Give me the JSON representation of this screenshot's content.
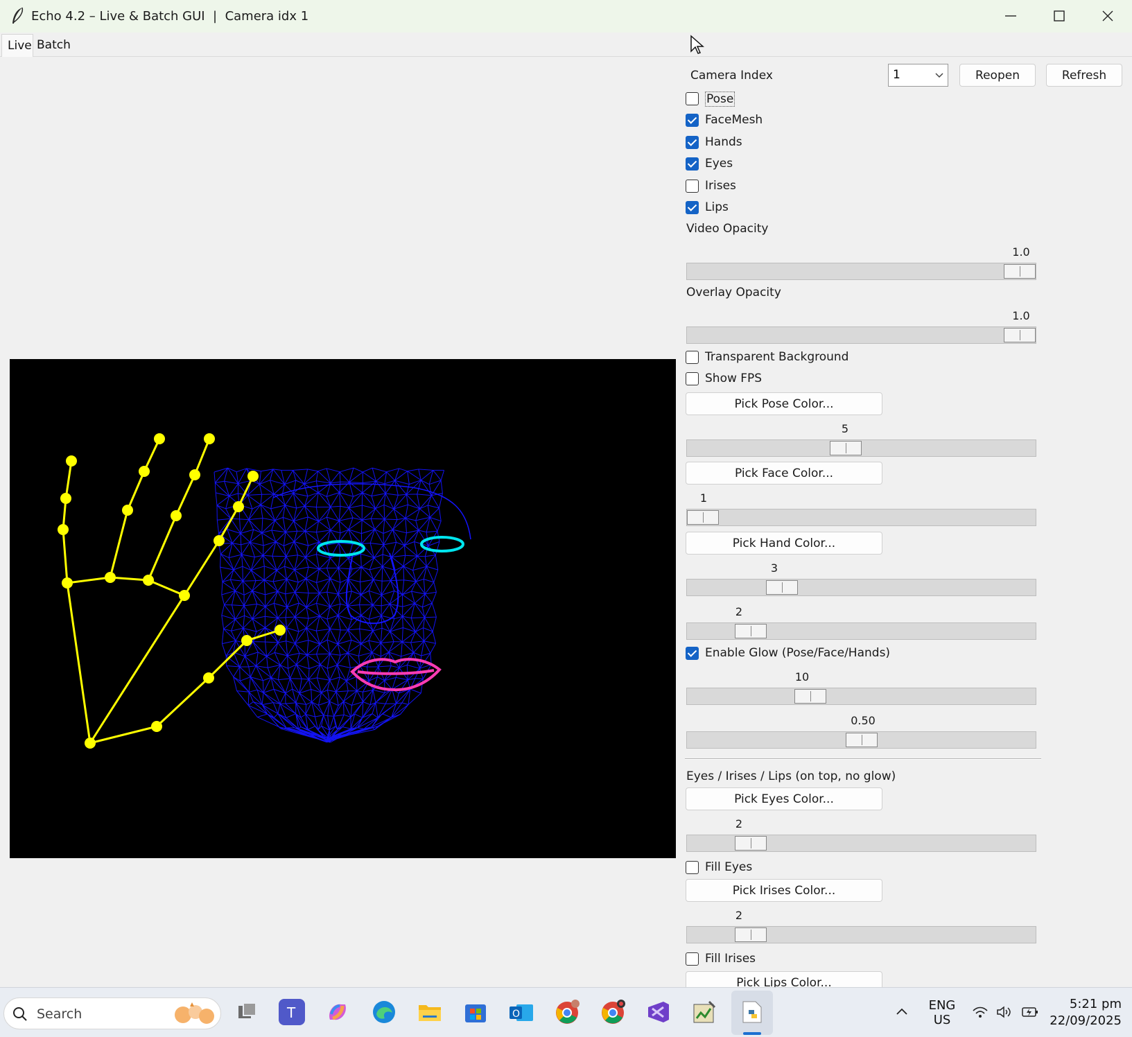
{
  "window": {
    "title": "Echo 4.2 – Live & Batch GUI  |  Camera idx 1"
  },
  "tabs": [
    {
      "label": "Live"
    },
    {
      "label": "Batch"
    }
  ],
  "camera": {
    "label": "Camera Index",
    "selected": "1",
    "reopen_label": "Reopen",
    "refresh_label": "Refresh"
  },
  "layers": [
    {
      "label": "Pose",
      "checked": false
    },
    {
      "label": "FaceMesh",
      "checked": true
    },
    {
      "label": "Hands",
      "checked": true
    },
    {
      "label": "Eyes",
      "checked": true
    },
    {
      "label": "Irises",
      "checked": false
    },
    {
      "label": "Lips",
      "checked": true
    }
  ],
  "video_opacity": {
    "label": "Video Opacity",
    "value": "1.0",
    "fraction": 1.0
  },
  "overlay_opacity": {
    "label": "Overlay Opacity",
    "value": "1.0",
    "fraction": 1.0
  },
  "transparent_bg": {
    "label": "Transparent Background",
    "checked": false
  },
  "show_fps": {
    "label": "Show FPS",
    "checked": false
  },
  "pose_color": {
    "label": "Pick Pose Color...",
    "thickness": "5",
    "fraction": 0.45
  },
  "face_color": {
    "label": "Pick Face Color...",
    "thickness": "1",
    "fraction": 0.0
  },
  "hand_color": {
    "label": "Pick Hand Color...",
    "thickness": "3",
    "fraction": 0.25
  },
  "hand_point": {
    "value": "2",
    "fraction": 0.15
  },
  "glow": {
    "label": "Enable Glow (Pose/Face/Hands)",
    "checked": true,
    "radius": "10",
    "radius_fraction": 0.34,
    "strength": "0.50",
    "strength_fraction": 0.5
  },
  "top_section": {
    "label": "Eyes / Irises / Lips (on top, no glow)"
  },
  "eyes_color": {
    "label": "Pick Eyes Color...",
    "thickness": "2",
    "fraction": 0.15
  },
  "fill_eyes": {
    "label": "Fill Eyes",
    "checked": false
  },
  "irises_color": {
    "label": "Pick Irises Color...",
    "thickness": "2",
    "fraction": 0.15
  },
  "fill_irises": {
    "label": "Fill Irises",
    "checked": false
  },
  "lips_color": {
    "label": "Pick Lips Color..."
  },
  "overlay_colors": {
    "hands": "#ffff00",
    "face": "#1414ff",
    "eyes": "#00e5ee",
    "lips": "#ff3cb4"
  },
  "taskbar": {
    "search_placeholder": "Search",
    "lang_top": "ENG",
    "lang_bottom": "US",
    "time": "5:21 pm",
    "date": "22/09/2025",
    "apps": [
      "task-view-icon",
      "teams-icon",
      "copilot-icon",
      "edge-icon",
      "file-explorer-icon",
      "store-icon",
      "outlook-icon",
      "chrome-icon",
      "chrome-profile-icon",
      "visual-studio-icon",
      "python-idle-icon",
      "python-app-icon"
    ]
  }
}
